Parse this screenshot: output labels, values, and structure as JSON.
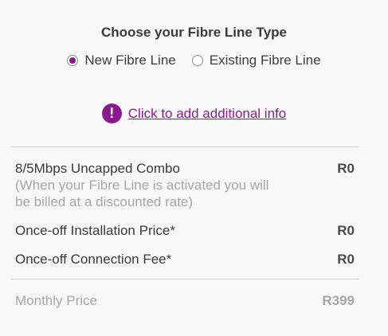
{
  "section_title": "Choose your Fibre Line Type",
  "line_type": {
    "options": [
      {
        "label": "New Fibre Line",
        "selected": true
      },
      {
        "label": "Existing Fibre Line",
        "selected": false
      }
    ]
  },
  "info": {
    "icon": "exclamation-icon",
    "link_text": "Click to add additional info"
  },
  "items": [
    {
      "label": "8/5Mbps Uncapped Combo",
      "amount": "R0"
    },
    {
      "label": "Once-off Installation Price*",
      "amount": "R0"
    },
    {
      "label": "Once-off Connection Fee*",
      "amount": "R0"
    }
  ],
  "combo_note": "(When your Fibre Line is activated you will be billed at a discounted rate)",
  "monthly": {
    "label": "Monthly Price",
    "amount": "R399"
  },
  "colors": {
    "accent": "#8b1a8e",
    "muted_text": "#a6a6a6",
    "background": "#f8f8f8"
  }
}
